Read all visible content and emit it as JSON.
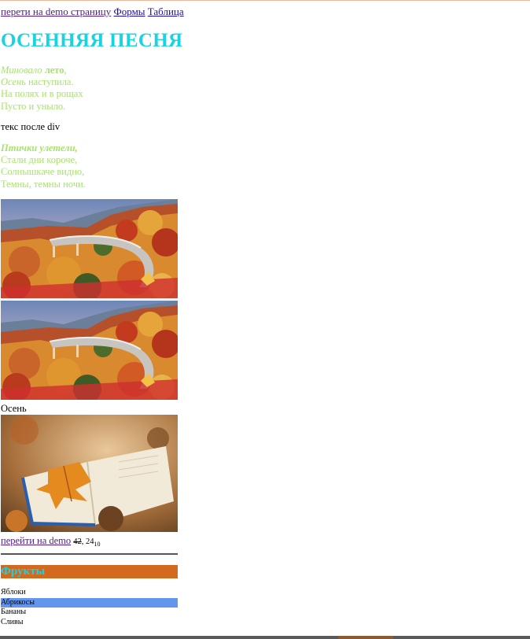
{
  "nav": {
    "link1": "перети на demo страницу",
    "link2": "Формы",
    "link3": "Таблица"
  },
  "title": "ОСЕННЯЯ ПЕСНЯ",
  "stanza1": {
    "line1_italic": "Миновало",
    "line1_bold": "лето",
    "line1_end": ",",
    "line2_italic": "Осень",
    "line2_rest": " наступила.",
    "line3": "На полях и в рощах",
    "line4": "Пусто и уныло."
  },
  "after_div": "текс после div",
  "stanza2": {
    "line1": "Птички улетели,",
    "line2": "Стали дни короче,",
    "line3": "Солнышкаче видно,",
    "line4": "Темны, темны ночи."
  },
  "caption": "Осень",
  "demo_line": {
    "link": "перейти на demo",
    "strike": "42",
    "mid": ", 24",
    "sub": "10"
  },
  "fruits": {
    "heading": "Фрукты",
    "items": [
      "Яблоки",
      "Абрикосы",
      "Бананы",
      "Сливы"
    ],
    "selected_index": 1
  },
  "colors": {
    "title": "#19d3e3",
    "poem": "#a7e36d",
    "fruits_bg": "#d2691e",
    "selected": "#6495ed"
  }
}
